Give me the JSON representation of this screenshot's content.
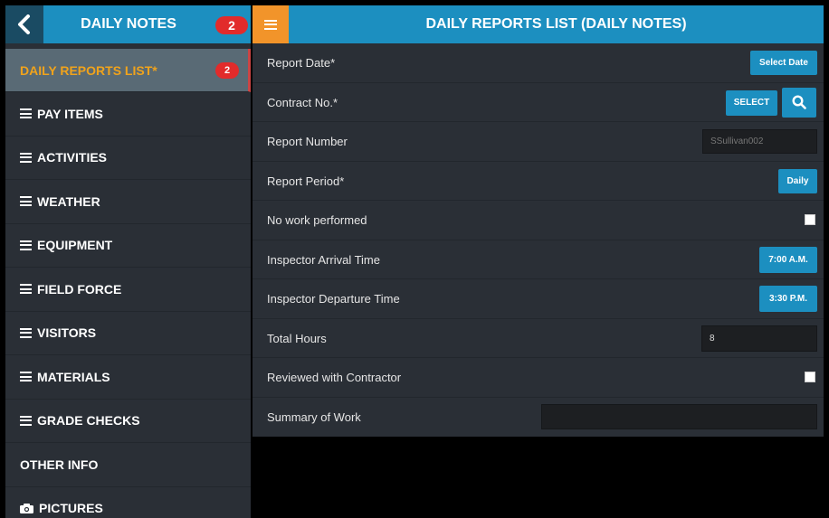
{
  "sidebar": {
    "title": "DAILY NOTES",
    "badge": "2",
    "items": [
      {
        "label": "DAILY REPORTS LIST*",
        "badge": "2",
        "icon": "none"
      },
      {
        "label": "PAY ITEMS",
        "icon": "list-icon"
      },
      {
        "label": "ACTIVITIES",
        "icon": "list-icon"
      },
      {
        "label": "WEATHER",
        "icon": "list-icon"
      },
      {
        "label": "EQUIPMENT",
        "icon": "list-icon"
      },
      {
        "label": "FIELD FORCE",
        "icon": "list-icon"
      },
      {
        "label": "VISITORS",
        "icon": "list-icon"
      },
      {
        "label": "MATERIALS",
        "icon": "list-icon"
      },
      {
        "label": "GRADE CHECKS",
        "icon": "list-icon"
      },
      {
        "label": "OTHER INFO",
        "icon": "none"
      },
      {
        "label": "PICTURES",
        "icon": "camera-icon"
      }
    ]
  },
  "header": {
    "title": "DAILY REPORTS LIST (DAILY NOTES)"
  },
  "form": {
    "report_date": {
      "label": "Report Date*",
      "button": "Select Date"
    },
    "contract_no": {
      "label": "Contract No.*",
      "button": "SELECT"
    },
    "report_number": {
      "label": "Report Number",
      "value": "SSullivan002"
    },
    "report_period": {
      "label": "Report Period*",
      "button": "Daily"
    },
    "no_work": {
      "label": "No work performed"
    },
    "arrival": {
      "label": "Inspector Arrival Time",
      "button": "7:00 A.M."
    },
    "departure": {
      "label": "Inspector Departure Time",
      "button": "3:30 P.M."
    },
    "total_hours": {
      "label": "Total Hours",
      "value": "8"
    },
    "reviewed": {
      "label": "Reviewed with Contractor"
    },
    "summary": {
      "label": "Summary of Work",
      "value": ""
    }
  },
  "colors": {
    "accent": "#1c8fc0",
    "active_text": "#f0a31c",
    "badge": "#e22b2b",
    "menu_button": "#f2942a"
  }
}
